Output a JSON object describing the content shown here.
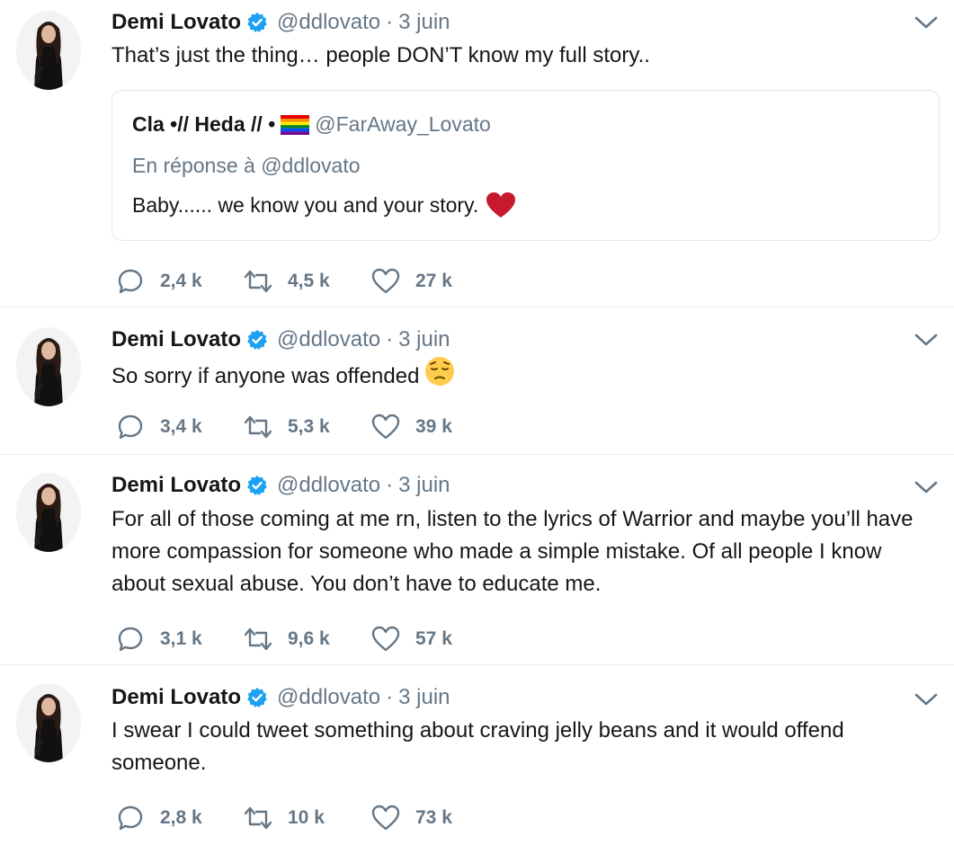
{
  "tweets": [
    {
      "name": "Demi Lovato",
      "handle": "@ddlovato",
      "sep": "·",
      "time": "3 juin",
      "text": "That’s just the thing… people DON’T know my full story..",
      "quote": {
        "name": "Cla •// Heda // •",
        "handle": "@FarAway_Lovato",
        "reply": "En réponse à @ddlovato",
        "text": "Baby...... we know you and your story."
      },
      "replies": "2,4 k",
      "retweets": "4,5 k",
      "likes": "27 k"
    },
    {
      "name": "Demi Lovato",
      "handle": "@ddlovato",
      "sep": "·",
      "time": "3 juin",
      "text": "So sorry if anyone was offended",
      "replies": "3,4 k",
      "retweets": "5,3 k",
      "likes": "39 k"
    },
    {
      "name": "Demi Lovato",
      "handle": "@ddlovato",
      "sep": "·",
      "time": "3 juin",
      "text": "For all of those coming at me rn, listen to the lyrics of Warrior and maybe you’ll have more compassion for someone who made a simple mistake. Of all people I know about sexual abuse. You don’t have to educate me.",
      "replies": "3,1 k",
      "retweets": "9,6 k",
      "likes": "57 k"
    },
    {
      "name": "Demi Lovato",
      "handle": "@ddlovato",
      "sep": "·",
      "time": "3 juin",
      "text": "I swear I could tweet something about craving jelly beans and it would offend someone.",
      "replies": "2,8 k",
      "retweets": "10 k",
      "likes": "73 k"
    }
  ],
  "icons": {
    "verified": "verified-badge-icon",
    "chevron": "chevron-down-icon",
    "reply": "reply-icon",
    "retweet": "retweet-icon",
    "like": "heart-outline-icon",
    "pensive": "pensive-face-emoji",
    "heart": "red-heart-emoji",
    "flag": "rainbow-flag-emoji"
  },
  "colors": {
    "verified": "#1da1f2",
    "muted": "#657786",
    "text": "#14171a",
    "divider": "#e6ecf0"
  }
}
